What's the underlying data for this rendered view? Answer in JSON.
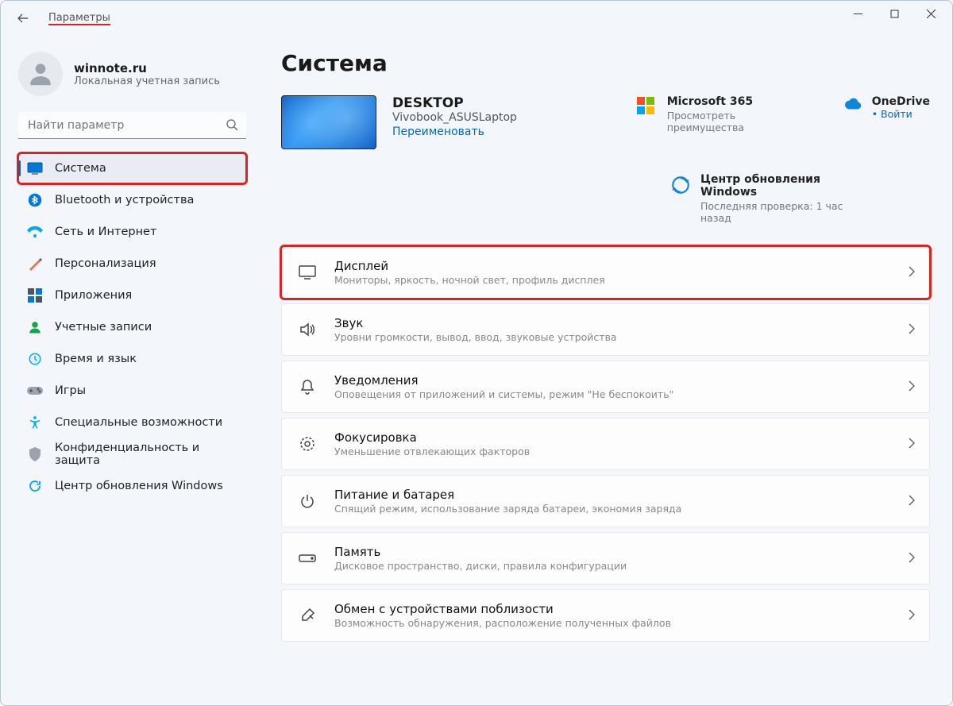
{
  "app_title": "Параметры",
  "account": {
    "name": "winnote.ru",
    "sub": "Локальная учетная запись"
  },
  "search": {
    "placeholder": "Найти параметр"
  },
  "nav": [
    {
      "id": "system",
      "label": "Система",
      "active": true,
      "highlight": true
    },
    {
      "id": "bluetooth",
      "label": "Bluetooth и устройства"
    },
    {
      "id": "network",
      "label": "Сеть и Интернет"
    },
    {
      "id": "personalization",
      "label": "Персонализация"
    },
    {
      "id": "apps",
      "label": "Приложения"
    },
    {
      "id": "accounts",
      "label": "Учетные записи"
    },
    {
      "id": "time",
      "label": "Время и язык"
    },
    {
      "id": "gaming",
      "label": "Игры"
    },
    {
      "id": "accessibility",
      "label": "Специальные возможности"
    },
    {
      "id": "privacy",
      "label": "Конфиденциальность и защита"
    },
    {
      "id": "update",
      "label": "Центр обновления Windows"
    }
  ],
  "page_title": "Система",
  "device": {
    "name": "DESKTOP",
    "model": "Vivobook_ASUSLaptop",
    "rename": "Переименовать"
  },
  "tiles": {
    "m365": {
      "title": "Microsoft 365",
      "sub": "Просмотреть преимущества"
    },
    "onedrive": {
      "title": "OneDrive",
      "link": "Войти"
    },
    "wu": {
      "title": "Центр обновления Windows",
      "sub": "Последняя проверка: 1 час назад"
    }
  },
  "settings": [
    {
      "id": "display",
      "title": "Дисплей",
      "sub": "Мониторы, яркость, ночной свет, профиль дисплея",
      "highlight": true
    },
    {
      "id": "sound",
      "title": "Звук",
      "sub": "Уровни громкости, вывод, ввод, звуковые устройства"
    },
    {
      "id": "notifications",
      "title": "Уведомления",
      "sub": "Оповещения от приложений и системы, режим \"Не беспокоить\""
    },
    {
      "id": "focus",
      "title": "Фокусировка",
      "sub": "Уменьшение отвлекающих факторов"
    },
    {
      "id": "power",
      "title": "Питание и батарея",
      "sub": "Спящий режим, использование заряда батареи, экономия заряда"
    },
    {
      "id": "storage",
      "title": "Память",
      "sub": "Дисковое пространство, диски, правила конфигурации"
    },
    {
      "id": "nearby",
      "title": "Обмен с устройствами поблизости",
      "sub": "Возможность обнаружения, расположение полученных файлов"
    }
  ]
}
